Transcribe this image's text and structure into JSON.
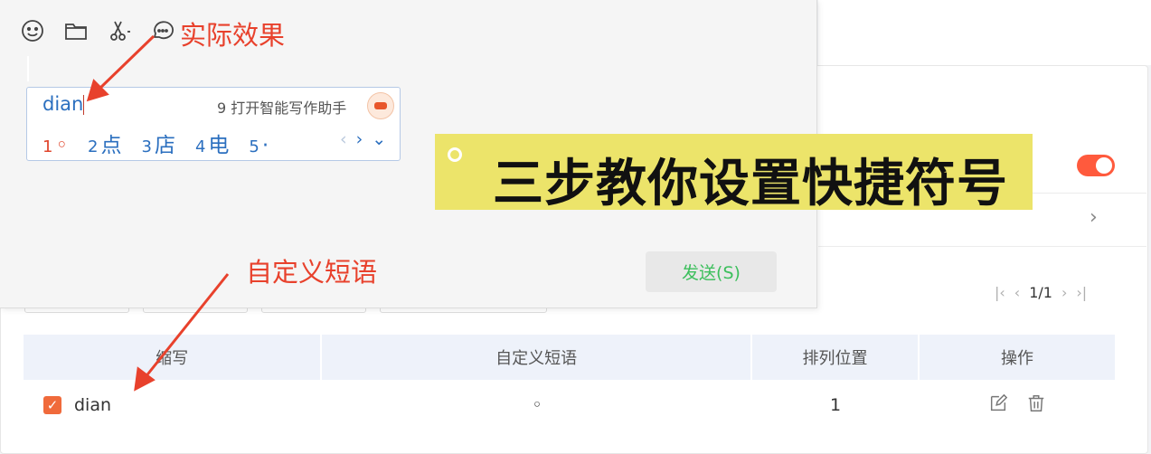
{
  "chat": {
    "toolbar": {
      "icons": [
        "emoji-icon",
        "folder-icon",
        "scissors-icon",
        "chat-bubble-icon"
      ]
    },
    "ime": {
      "input_text": "dian",
      "tip": "9 打开智能写作助手",
      "candidates": [
        {
          "num": "1",
          "text": "◦"
        },
        {
          "num": "2",
          "text": "点"
        },
        {
          "num": "3",
          "text": "店"
        },
        {
          "num": "4",
          "text": "电"
        },
        {
          "num": "5",
          "text": "·"
        }
      ],
      "nav": [
        "‹",
        "›",
        "⌄"
      ]
    },
    "send_label": "发送(S)"
  },
  "annotations": {
    "actual_effect": "实际效果",
    "custom_phrase": "自定义短语",
    "color": "#e8412c"
  },
  "banner": {
    "text": "三步教你设置快捷符号",
    "bg_color": "#ece46a"
  },
  "settings": {
    "toggle_on": true,
    "toggle_color": "#ff5a3d",
    "pager": {
      "first": "|‹",
      "prev": "‹",
      "page": "1/1",
      "next": "›",
      "last": "›|"
    }
  },
  "table": {
    "headers": [
      "缩写",
      "自定义短语",
      "排列位置",
      "操作"
    ],
    "rows": [
      {
        "checked": true,
        "abbr": "dian",
        "phrase": "◦",
        "position": "1"
      }
    ]
  }
}
